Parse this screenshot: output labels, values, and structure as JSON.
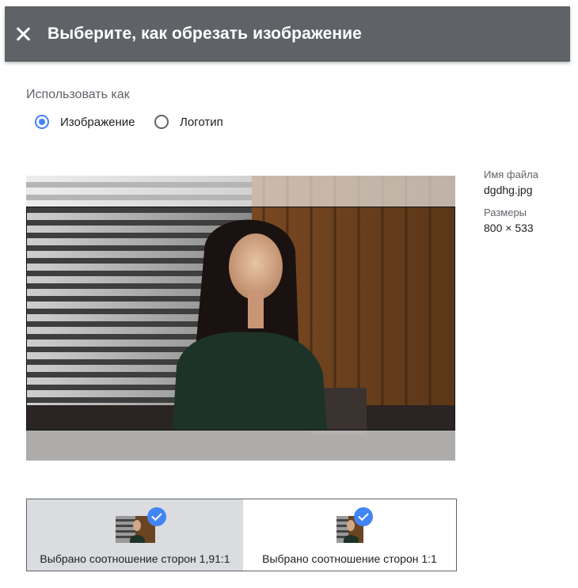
{
  "header": {
    "title": "Выберите, как обрезать изображение",
    "close_icon": "close-icon"
  },
  "use_as": {
    "label": "Использовать как",
    "options": [
      {
        "label": "Изображение",
        "selected": true
      },
      {
        "label": "Логотип",
        "selected": false
      }
    ]
  },
  "file_info": {
    "filename_label": "Имя файла",
    "filename": "dgdhg.jpg",
    "dimensions_label": "Размеры",
    "dimensions": "800 × 533"
  },
  "aspect_ratios": [
    {
      "label": "Выбрано соотношение сторон 1,91:1",
      "active": true,
      "checked": true
    },
    {
      "label": "Выбрано соотношение сторон 1:1",
      "active": false,
      "checked": true
    }
  ],
  "colors": {
    "header_bg": "#5f6368",
    "accent": "#4285f4",
    "selected_option_bg": "#dadce0"
  }
}
